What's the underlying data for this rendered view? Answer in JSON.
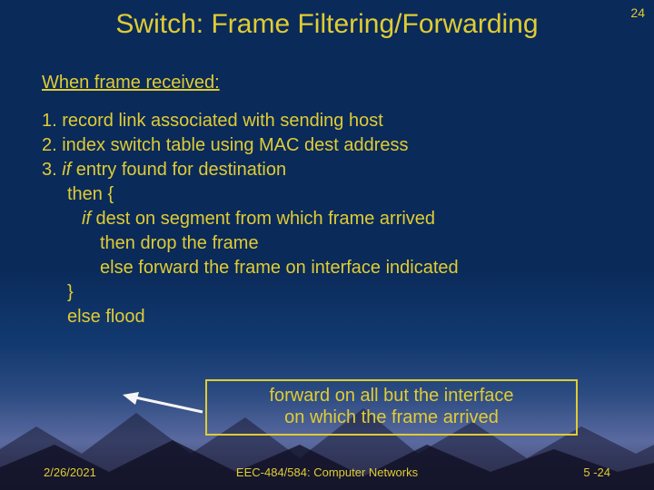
{
  "pageCorner": "24",
  "title": "Switch: Frame Filtering/Forwarding",
  "subhead": "When  frame received:",
  "line1": "1. record link associated with sending host",
  "line2": "2. index switch table using MAC dest address",
  "line3a": "3. ",
  "line3if": "if",
  "line3b": " entry found for destination",
  "then_open": "then {",
  "inner_if": "if",
  "inner_if_rest": " dest on segment from which frame arrived",
  "inner_then": "then",
  "inner_then_rest": " drop the frame",
  "inner_else": "else",
  "inner_else_rest": " forward the frame on interface indicated",
  "close_brace": "}",
  "outer_else": "else",
  "outer_else_rest": " flood",
  "callout_l1": "forward on all but the interface",
  "callout_l2": "on which the frame arrived",
  "footer_date": "2/26/2021",
  "footer_course": "EEC-484/584: Computer Networks",
  "footer_pg": "5 -24"
}
